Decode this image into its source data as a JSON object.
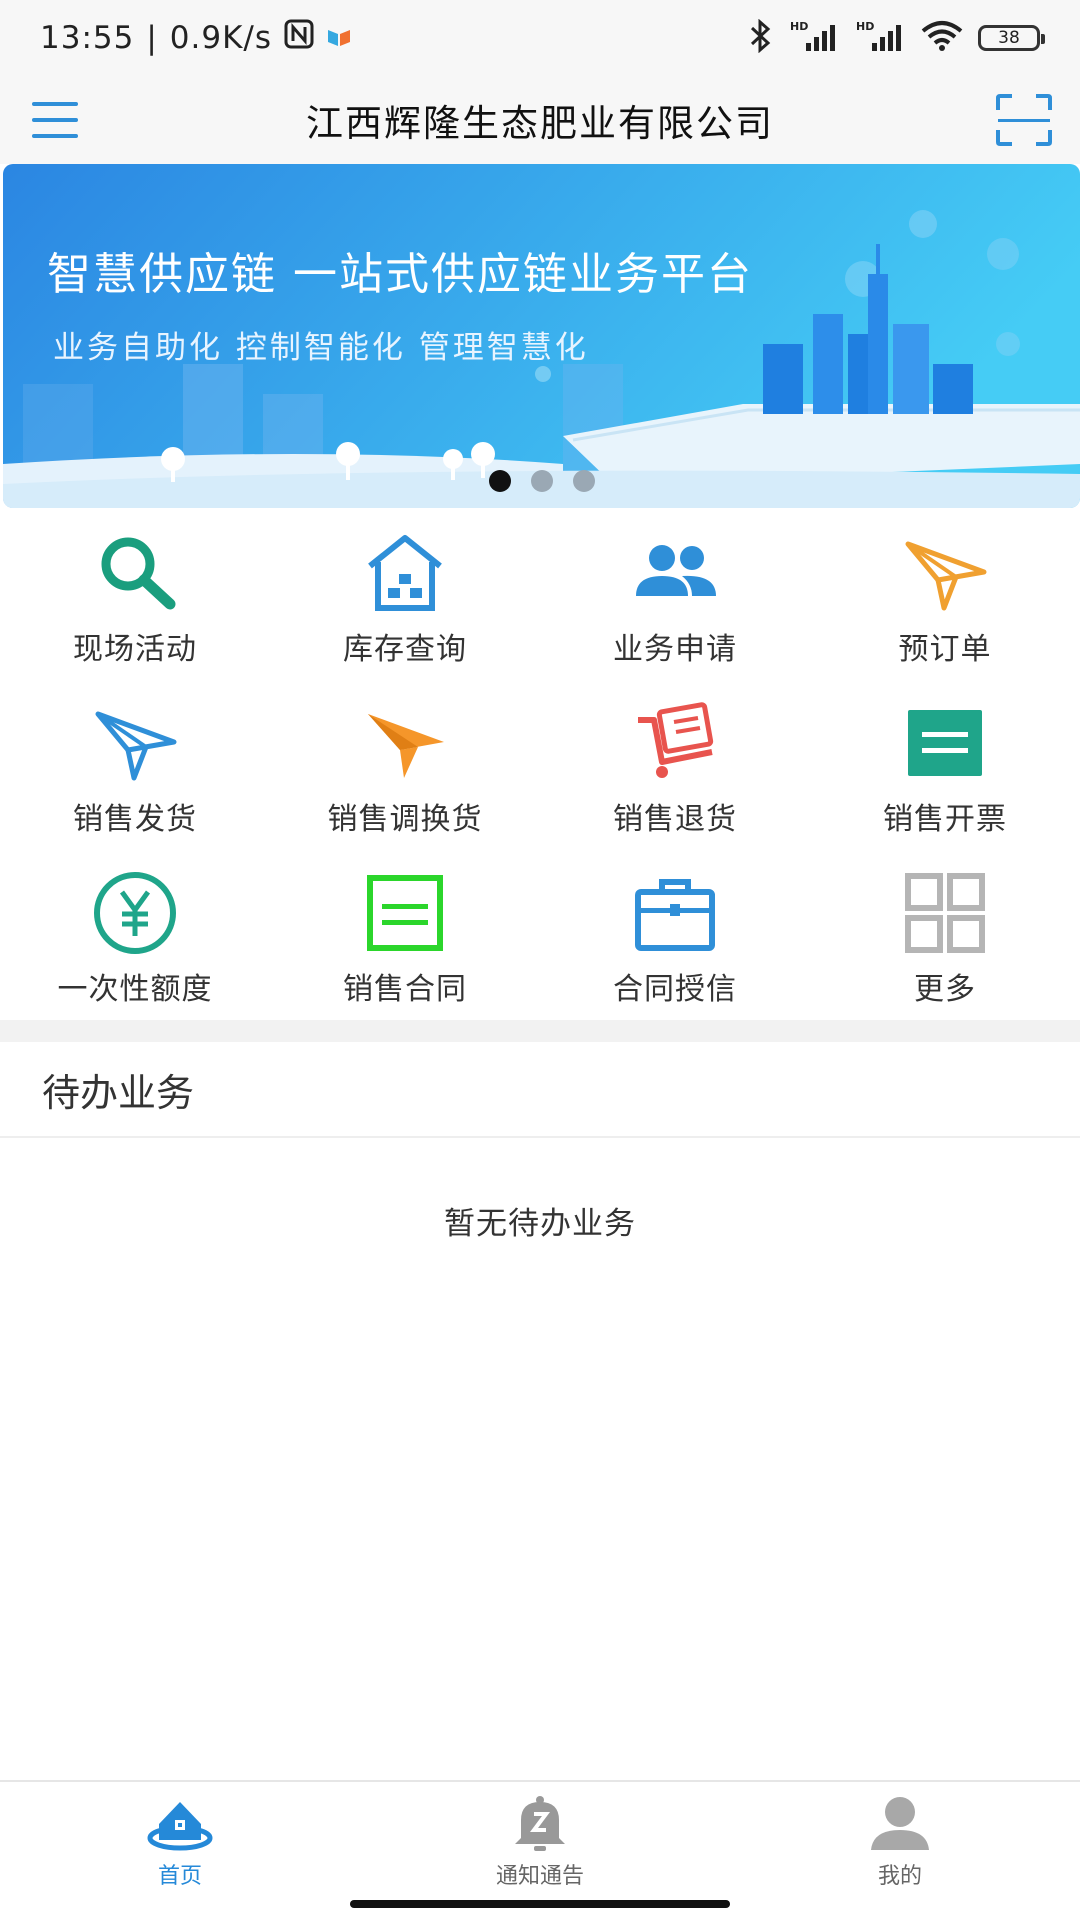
{
  "status_bar": {
    "time": "13:55",
    "separator": "|",
    "speed": "0.9K/s",
    "battery": "38",
    "icons": [
      "nfc-icon",
      "app-notification-icon",
      "bluetooth-icon",
      "hd-signal-icon",
      "hd-signal-icon",
      "wifi-icon",
      "battery-icon"
    ]
  },
  "header": {
    "title": "江西辉隆生态肥业有限公司",
    "left_icon": "menu-icon",
    "right_icon": "scan-icon"
  },
  "banner": {
    "title": "智慧供应链  一站式供应链业务平台",
    "subtitle": "业务自助化  控制智能化  管理智慧化",
    "active_slide": 1,
    "slide_count": 3
  },
  "grid": {
    "items": [
      {
        "label": "现场活动",
        "icon": "search-icon",
        "color": "#1a9e7e"
      },
      {
        "label": "库存查询",
        "icon": "warehouse-icon",
        "color": "#2f8fd8"
      },
      {
        "label": "业务申请",
        "icon": "users-icon",
        "color": "#2f8fd8"
      },
      {
        "label": "预订单",
        "icon": "paper-plane-outline-icon",
        "color": "#f0a030"
      },
      {
        "label": "销售发货",
        "icon": "paper-plane-outline-icon",
        "color": "#2f8fd8"
      },
      {
        "label": "销售调换货",
        "icon": "paper-plane-filled-icon",
        "color": "#f5962a"
      },
      {
        "label": "销售退货",
        "icon": "cart-return-icon",
        "color": "#e8544e"
      },
      {
        "label": "销售开票",
        "icon": "invoice-icon",
        "color": "#1fa58a"
      },
      {
        "label": "一次性额度",
        "icon": "yuan-icon",
        "color": "#1fa58a"
      },
      {
        "label": "销售合同",
        "icon": "contract-icon",
        "color": "#2bd62b"
      },
      {
        "label": "合同授信",
        "icon": "briefcase-icon",
        "color": "#2f8fd8"
      },
      {
        "label": "更多",
        "icon": "more-grid-icon",
        "color": "#b5b5b5"
      }
    ]
  },
  "pending": {
    "title": "待办业务",
    "empty_text": "暂无待办业务"
  },
  "bottom_nav": {
    "items": [
      {
        "label": "首页",
        "icon": "home-icon",
        "active": true
      },
      {
        "label": "通知通告",
        "icon": "bell-icon",
        "active": false
      },
      {
        "label": "我的",
        "icon": "user-icon",
        "active": false
      }
    ],
    "active_color": "#2589d8",
    "inactive_color": "#999999"
  }
}
